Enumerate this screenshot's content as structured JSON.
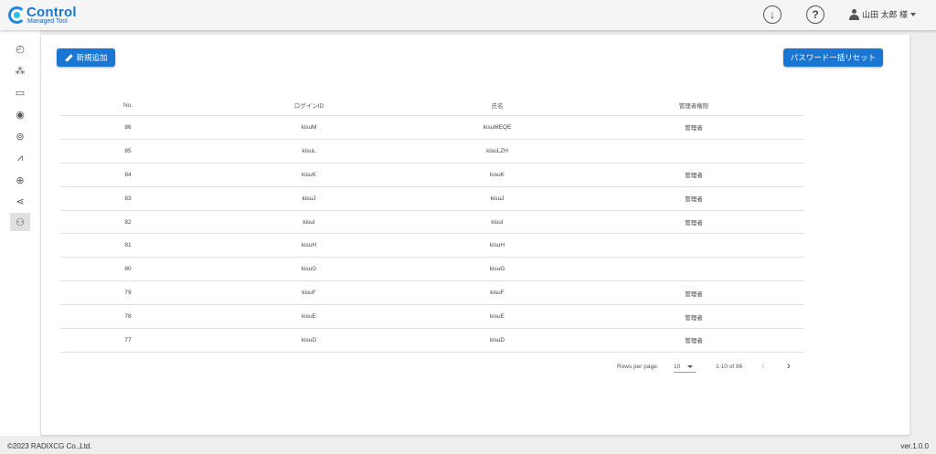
{
  "app": {
    "title": "Control",
    "subtitle": "Managed Tool"
  },
  "header": {
    "user_name": "山田 太郎 様",
    "download_icon": "download-icon",
    "help_icon": "help-icon"
  },
  "sidebar": {
    "items": [
      {
        "icon": "dashboard-icon",
        "glyph": "◴"
      },
      {
        "icon": "group-icon",
        "glyph": "⁂"
      },
      {
        "icon": "computer-icon",
        "glyph": "▭"
      },
      {
        "icon": "disc-icon",
        "glyph": "◉"
      },
      {
        "icon": "badge-icon",
        "glyph": "⊚"
      },
      {
        "icon": "chart-icon",
        "glyph": "⩘"
      },
      {
        "icon": "globe-icon",
        "glyph": "⊕"
      },
      {
        "icon": "share-icon",
        "glyph": "⋖"
      },
      {
        "icon": "user-settings-icon",
        "glyph": "⚇"
      }
    ]
  },
  "toolbar": {
    "add_label": "新規追加",
    "reset_label": "パスワード一括リセット"
  },
  "table": {
    "headers": [
      "No.",
      "ログインID",
      "氏名",
      "管理者権限"
    ],
    "rows": [
      [
        "86",
        "kisuM",
        "kisuMEQE",
        "管理者"
      ],
      [
        "85",
        "kisuL",
        "kisuLZH",
        ""
      ],
      [
        "84",
        "kisuK",
        "kisuK",
        "管理者"
      ],
      [
        "83",
        "kisuJ",
        "kisuJ",
        "管理者"
      ],
      [
        "82",
        "kisuI",
        "kisuI",
        "管理者"
      ],
      [
        "81",
        "kisuH",
        "kisuH",
        ""
      ],
      [
        "80",
        "kisuG",
        "kisuG",
        ""
      ],
      [
        "79",
        "kisuF",
        "kisuF",
        "管理者"
      ],
      [
        "78",
        "kisuE",
        "kisuE",
        "管理者"
      ],
      [
        "77",
        "kisuD",
        "kisuD",
        "管理者"
      ]
    ]
  },
  "pagination": {
    "rows_label": "Rows per page:",
    "rows_value": "10",
    "range": "1-10 of 86",
    "prev": "‹",
    "next": "›"
  },
  "footer": {
    "copyright": "©2023 RADIXCG Co.,Ltd.",
    "version": "ver.1.0.0"
  }
}
